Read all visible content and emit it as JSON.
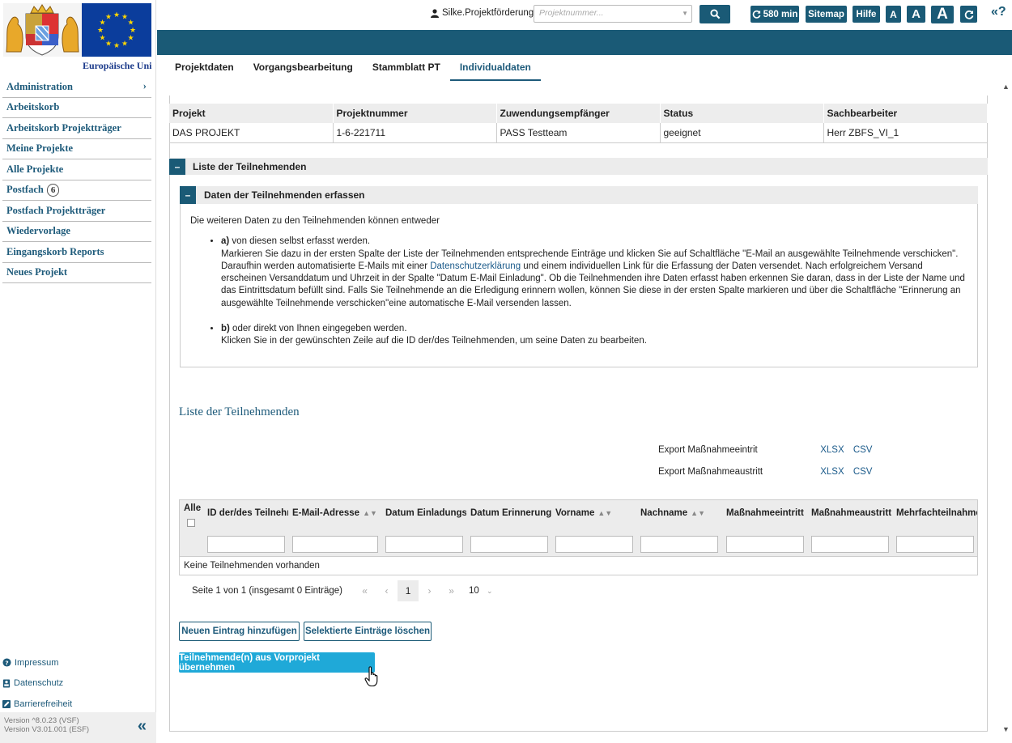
{
  "sidebar": {
    "eu_caption": "Europäische Uni",
    "nav": [
      {
        "label": "Administration",
        "chev": "›"
      },
      {
        "label": "Arbeitskorb"
      },
      {
        "label": "Arbeitskorb Projektträger"
      },
      {
        "label": "Meine Projekte"
      },
      {
        "label": "Alle Projekte"
      },
      {
        "label": "Postfach",
        "badge": "6"
      },
      {
        "label": "Postfach Projektträger"
      },
      {
        "label": "Wiedervorlage"
      },
      {
        "label": "Eingangskorb Reports"
      },
      {
        "label": "Neues Projekt"
      }
    ],
    "footer_links": [
      "Impressum",
      "Datenschutz",
      "Barrierefreiheit"
    ],
    "version_1": "Version ^8.0.23 (VSF)",
    "version_2": "Version V3.01.001 (ESF)",
    "collapse_glyph": "«"
  },
  "topbar": {
    "user": "Silke.Projektförderung",
    "search_placeholder": "Projektnummer...",
    "timer": "580 min",
    "sitemap": "Sitemap",
    "help": "Hilfe",
    "font_small": "A",
    "font_mid": "A",
    "font_large": "A",
    "help_toggle": "«?",
    "accent_color": "#1a5a76"
  },
  "tabs": [
    "Projektdaten",
    "Vorgangsbearbeitung",
    "Stammblatt PT",
    "Individualdaten"
  ],
  "project": {
    "headers": [
      "Projekt",
      "Projektnummer",
      "Zuwendungsempfänger",
      "Status",
      "Sachbearbeiter"
    ],
    "row": [
      "DAS PROJEKT",
      "1-6-221711",
      "PASS Testteam",
      "geeignet",
      "Herr ZBFS_VI_1"
    ]
  },
  "section_outer": "Liste der Teilnehmenden",
  "section_inner": "Daten der Teilnehmenden erfassen",
  "info": {
    "intro": "Die weiteren Daten zu den Teilnehmenden können entweder",
    "a_label": "a)",
    "a_head": " von diesen selbst erfasst werden.",
    "a_text_1": "Markieren Sie dazu in der ersten Spalte der Liste der Teilnehmenden entsprechende Einträge und klicken Sie auf Schaltfläche \"E-Mail an ausgewählte Teilnehmende verschicken\". Daraufhin werden automatisierte E-Mails mit einer ",
    "a_link": "Datenschutzerklärung",
    "a_text_2": " und einem individuellen Link für die Erfassung der Daten versendet. Nach erfolgreichem Versand erscheinen Versanddatum und Uhrzeit in der Spalte \"Datum E-Mail Einladung\". Ob die Teilnehmenden ihre Daten erfasst haben erkennen Sie daran, dass in der Liste der Name und das Eintrittsdatum befüllt sind. Falls Sie Teilnehmende an die Erledigung erinnern wollen, können Sie diese in der ersten Spalte markieren und über die Schaltfläche \"Erinnerung an ausgewählte Teilnehmende verschicken\"eine automatische E-Mail versenden lassen.",
    "b_label": "b)",
    "b_head": " oder direkt von Ihnen eingegeben werden.",
    "b_text": "Klicken Sie in der gewünschten Zeile auf die ID der/des Teilnehmenden, um seine Daten zu bearbeiten."
  },
  "list_title": "Liste der Teilnehmenden",
  "exports": [
    {
      "label": "Export Maßnahmeeintrit",
      "xlsx": "XLSX",
      "csv": "CSV"
    },
    {
      "label": "Export Maßnahmeaustritt",
      "xlsx": "XLSX",
      "csv": "CSV"
    }
  ],
  "grid": {
    "all_label": "Alle",
    "columns": [
      "ID der/des Teilnehmenden",
      "E-Mail-Adresse",
      "Datum Einladungs-",
      "Datum Erinnerungs",
      "Vorname",
      "Nachname",
      "Maßnahmeeintritt",
      "Maßnahmeaustritt",
      "Mehrfachteilnahme"
    ],
    "empty": "Keine Teilnehmenden vorhanden"
  },
  "pager": {
    "summary": "Seite 1 von 1 (insgesamt 0 Einträge)",
    "first": "«",
    "prev": "‹",
    "current": "1",
    "next": "›",
    "last": "»",
    "page_size": "10"
  },
  "buttons": {
    "add": "Neuen Eintrag hinzufügen",
    "delete": "Selektierte Einträge löschen",
    "copy": "Teilnehmende(n) aus Vorprojekt übernehmen"
  }
}
